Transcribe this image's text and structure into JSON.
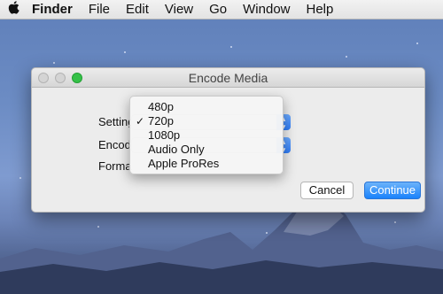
{
  "menubar": {
    "apple_icon": "apple-icon",
    "app_name": "Finder",
    "items": [
      "File",
      "Edit",
      "View",
      "Go",
      "Window",
      "Help"
    ]
  },
  "window": {
    "title": "Encode Media",
    "rows": [
      {
        "label": "Setting"
      },
      {
        "label": "Encod"
      },
      {
        "label": "Forma"
      }
    ],
    "dropdown": {
      "options": [
        {
          "label": "480p",
          "checked": false
        },
        {
          "label": "720p",
          "checked": true
        },
        {
          "label": "1080p",
          "checked": false
        },
        {
          "label": "Audio Only",
          "checked": false
        },
        {
          "label": "Apple ProRes",
          "checked": false
        }
      ],
      "check_glyph": "✓"
    },
    "buttons": {
      "cancel": "Cancel",
      "continue": "Continue"
    },
    "accent_color": "#1a82fb"
  }
}
